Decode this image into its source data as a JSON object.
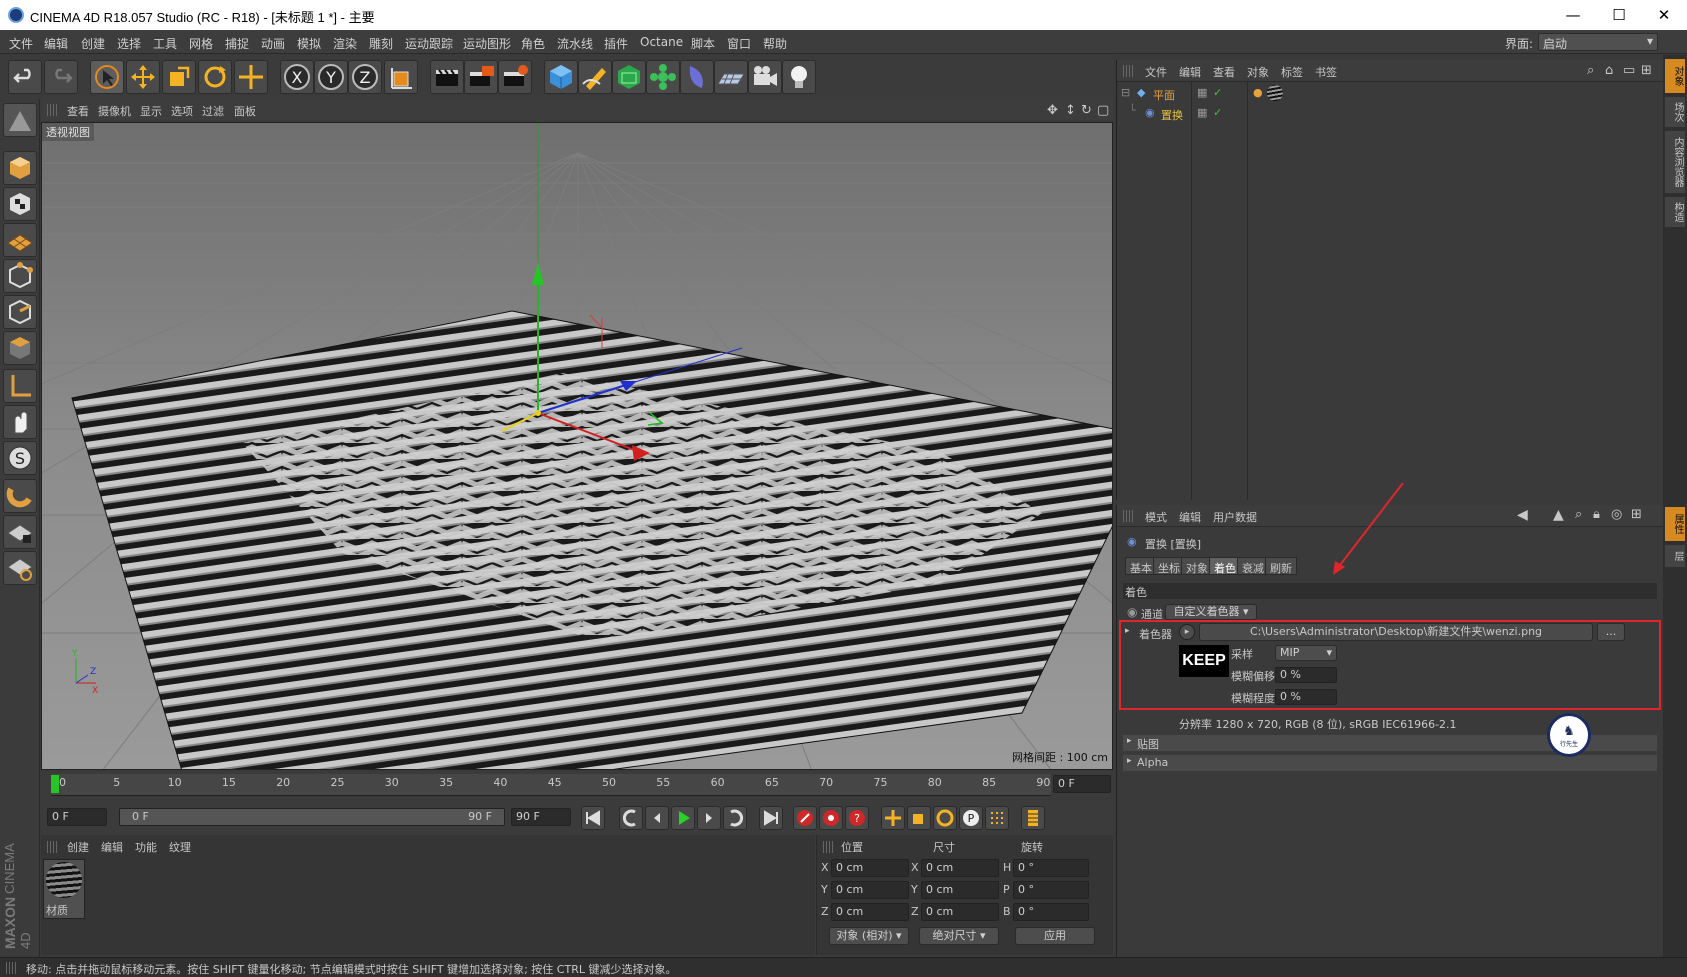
{
  "window": {
    "title": "CINEMA 4D R18.057 Studio (RC - R18) - [未标题 1 *] - 主要",
    "controls": {
      "minimize": "—",
      "maximize": "☐",
      "close": "✕"
    }
  },
  "menu": {
    "items": [
      "文件",
      "编辑",
      "创建",
      "选择",
      "工具",
      "网格",
      "捕捉",
      "动画",
      "模拟",
      "渲染",
      "雕刻",
      "运动跟踪",
      "运动图形",
      "角色",
      "流水线",
      "插件",
      "Octane",
      "脚本",
      "窗口",
      "帮助"
    ],
    "layout_label": "界面:",
    "layout_value": "启动"
  },
  "toolbar": {
    "icons": [
      "undo-icon",
      "redo-icon",
      "select-icon",
      "move-icon",
      "scale-icon",
      "rotate-icon",
      "live-select-icon",
      "x-axis-icon",
      "y-axis-icon",
      "z-axis-icon",
      "coord-system-icon",
      "render-view-icon",
      "render-picture-viewer-icon",
      "render-settings-icon",
      "cube-icon",
      "pen-icon",
      "subdivision-icon",
      "cloner-icon",
      "deformer-icon",
      "floor-icon",
      "camera-icon",
      "light-icon"
    ],
    "axis_labels": [
      "X",
      "Y",
      "Z"
    ]
  },
  "viewport": {
    "menu": [
      "查看",
      "摄像机",
      "显示",
      "选项",
      "过滤",
      "面板"
    ],
    "label": "透视视图",
    "grid_spacing": "网格间距 : 100 cm"
  },
  "timeline": {
    "ticks": [
      "0",
      "5",
      "10",
      "15",
      "20",
      "25",
      "30",
      "35",
      "40",
      "45",
      "50",
      "55",
      "60",
      "65",
      "70",
      "75",
      "80",
      "85",
      "90"
    ],
    "current_frame_display": "0 F"
  },
  "playback": {
    "start_field": "0 F",
    "range_left": "0 F",
    "range_right": "90 F",
    "end_field": "90 F"
  },
  "material_panel": {
    "menu": [
      "创建",
      "编辑",
      "功能",
      "纹理"
    ],
    "material_name": "材质"
  },
  "coordinates": {
    "headers": [
      "位置",
      "尺寸",
      "旋转"
    ],
    "rows": [
      {
        "a": "X",
        "pos": "0 cm",
        "b": "X",
        "size": "0 cm",
        "c": "H",
        "rot": "0 °"
      },
      {
        "a": "Y",
        "pos": "0 cm",
        "b": "Y",
        "size": "0 cm",
        "c": "P",
        "rot": "0 °"
      },
      {
        "a": "Z",
        "pos": "0 cm",
        "b": "Z",
        "size": "0 cm",
        "c": "B",
        "rot": "0 °"
      }
    ],
    "mode_object": "对象 (相对)",
    "mode_size": "绝对尺寸",
    "apply": "应用"
  },
  "object_manager": {
    "menu": [
      "文件",
      "编辑",
      "查看",
      "对象",
      "标签",
      "书签"
    ],
    "objects": [
      {
        "name": "平面",
        "color": "#e8a33a"
      },
      {
        "name": "置换",
        "color": "#e8c040"
      }
    ]
  },
  "attribute_manager": {
    "menu": [
      "模式",
      "编辑",
      "用户数据"
    ],
    "object_title": "置换 [置换]",
    "tabs": [
      "基本",
      "坐标",
      "对象",
      "着色",
      "衰减",
      "刷新"
    ],
    "active_tab": 3,
    "section": "着色",
    "channel_label": "通道",
    "channel_value": "自定义着色器",
    "shader_label": "着色器",
    "shader_path": "C:\\Users\\Administrator\\Desktop\\新建文件夹\\wenzi.png",
    "browse": "...",
    "thumb_text": "KEEP",
    "sampling_label": "采样",
    "sampling_value": "MIP",
    "blur_offset_label": "模糊偏移",
    "blur_offset_value": "0 %",
    "blur_scale_label": "模糊程度",
    "blur_scale_value": "0 %",
    "resolution": "分辨率 1280 x 720, RGB (8 位), sRGB IEC61966-2.1",
    "collapsed": [
      "贴图",
      "Alpha"
    ]
  },
  "right_strip": {
    "tabs": [
      "对象",
      "场次",
      "内容浏览器",
      "构造"
    ],
    "tabs2": [
      "属性",
      "层"
    ]
  },
  "watermark": "行先生",
  "left_brand": {
    "a": "MAXON",
    "b": "CINEMA 4D"
  },
  "status": "移动: 点击并拖动鼠标移动元素。按住 SHIFT 键量化移动; 节点编辑模式时按住 SHIFT 键增加选择对象; 按住 CTRL 键减少选择对象。",
  "colors": {
    "accent_orange": "#e8a33a",
    "highlight_red": "#e0262a",
    "axis_green": "#22b822",
    "axis_red": "#d02020",
    "axis_blue": "#2030d0"
  }
}
